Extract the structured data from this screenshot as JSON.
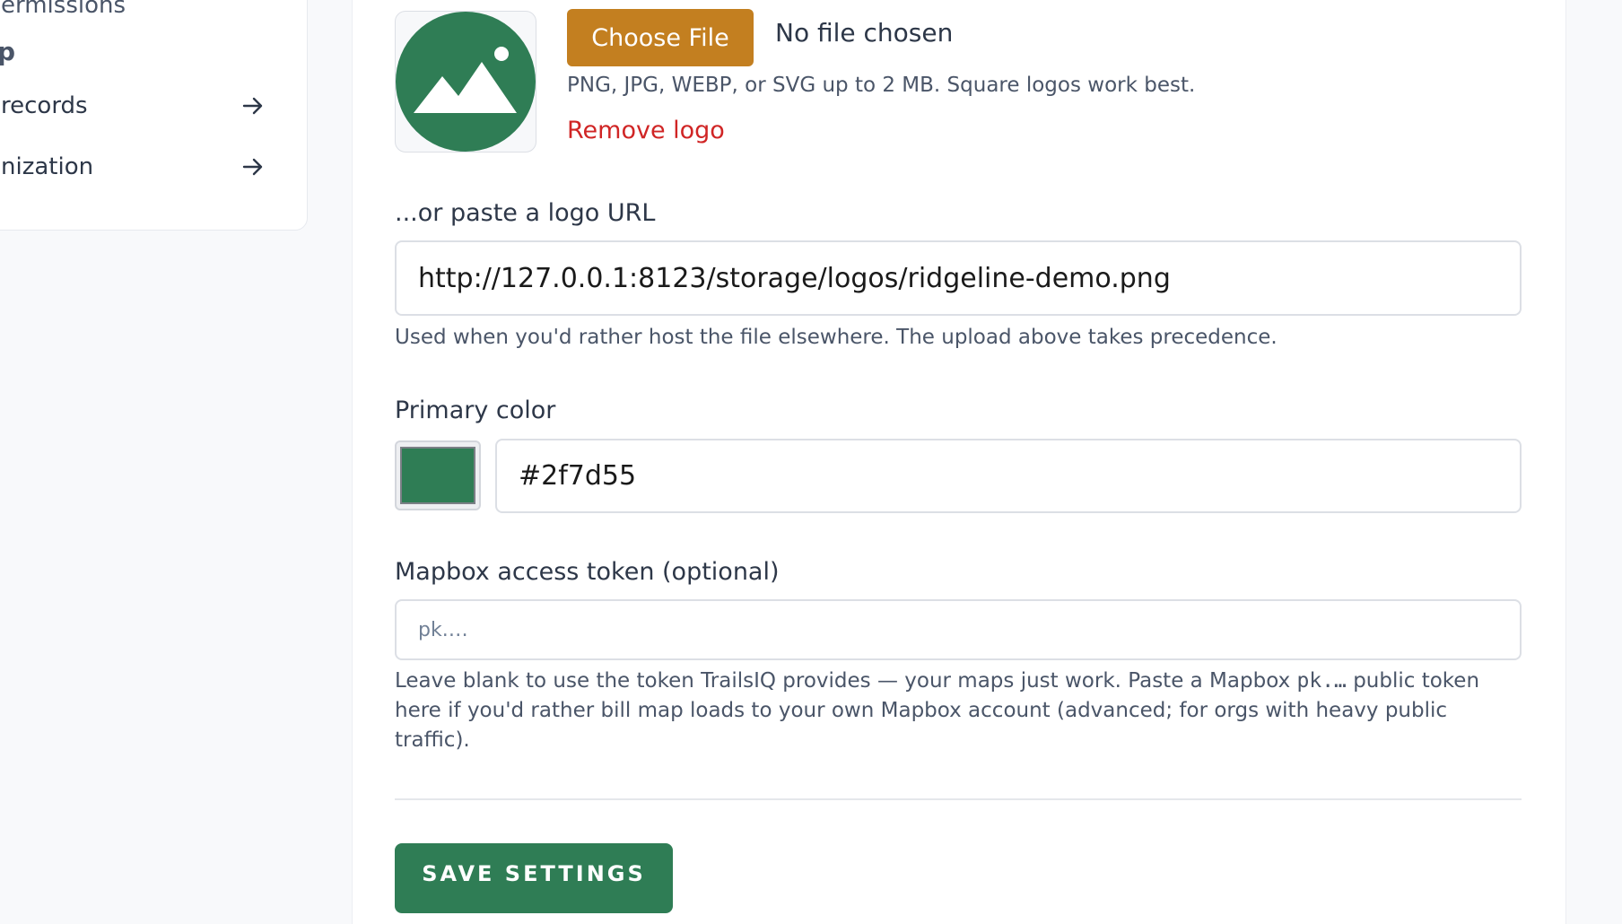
{
  "sidebar": {
    "partial_top": "ermissions",
    "partial_heading": "p",
    "items": [
      {
        "label": "records",
        "icon": "arrow-right-icon"
      },
      {
        "label": "nization",
        "icon": "arrow-right-icon"
      }
    ]
  },
  "logo": {
    "icon": "image-placeholder-icon",
    "color": "#2f7d55",
    "choose_button": "Choose File",
    "file_status": "No file chosen",
    "hint": "PNG, JPG, WEBP, or SVG up to 2 MB. Square logos work best.",
    "remove_label": "Remove logo"
  },
  "logo_url": {
    "label": "...or paste a logo URL",
    "value": "http://127.0.0.1:8123/storage/logos/ridgeline-demo.png",
    "help": "Used when you'd rather host the file elsewhere. The upload above takes precedence."
  },
  "primary_color": {
    "label": "Primary color",
    "value": "#2f7d55",
    "swatch_color": "#2f7d55"
  },
  "mapbox": {
    "label": "Mapbox access token (optional)",
    "placeholder": "pk.…",
    "help_part1": "Leave blank to use the token TrailsIQ provides — your maps just work. Paste a Mapbox ",
    "help_code": "pk.…",
    "help_part2": " public token here if you'd rather bill map loads to your own Mapbox account (advanced; for orgs with heavy public traffic)."
  },
  "save_button": "SAVE SETTINGS",
  "colors": {
    "accent_gold": "#c37f20",
    "brand_green": "#2f7d55",
    "danger_red": "#d02525"
  }
}
